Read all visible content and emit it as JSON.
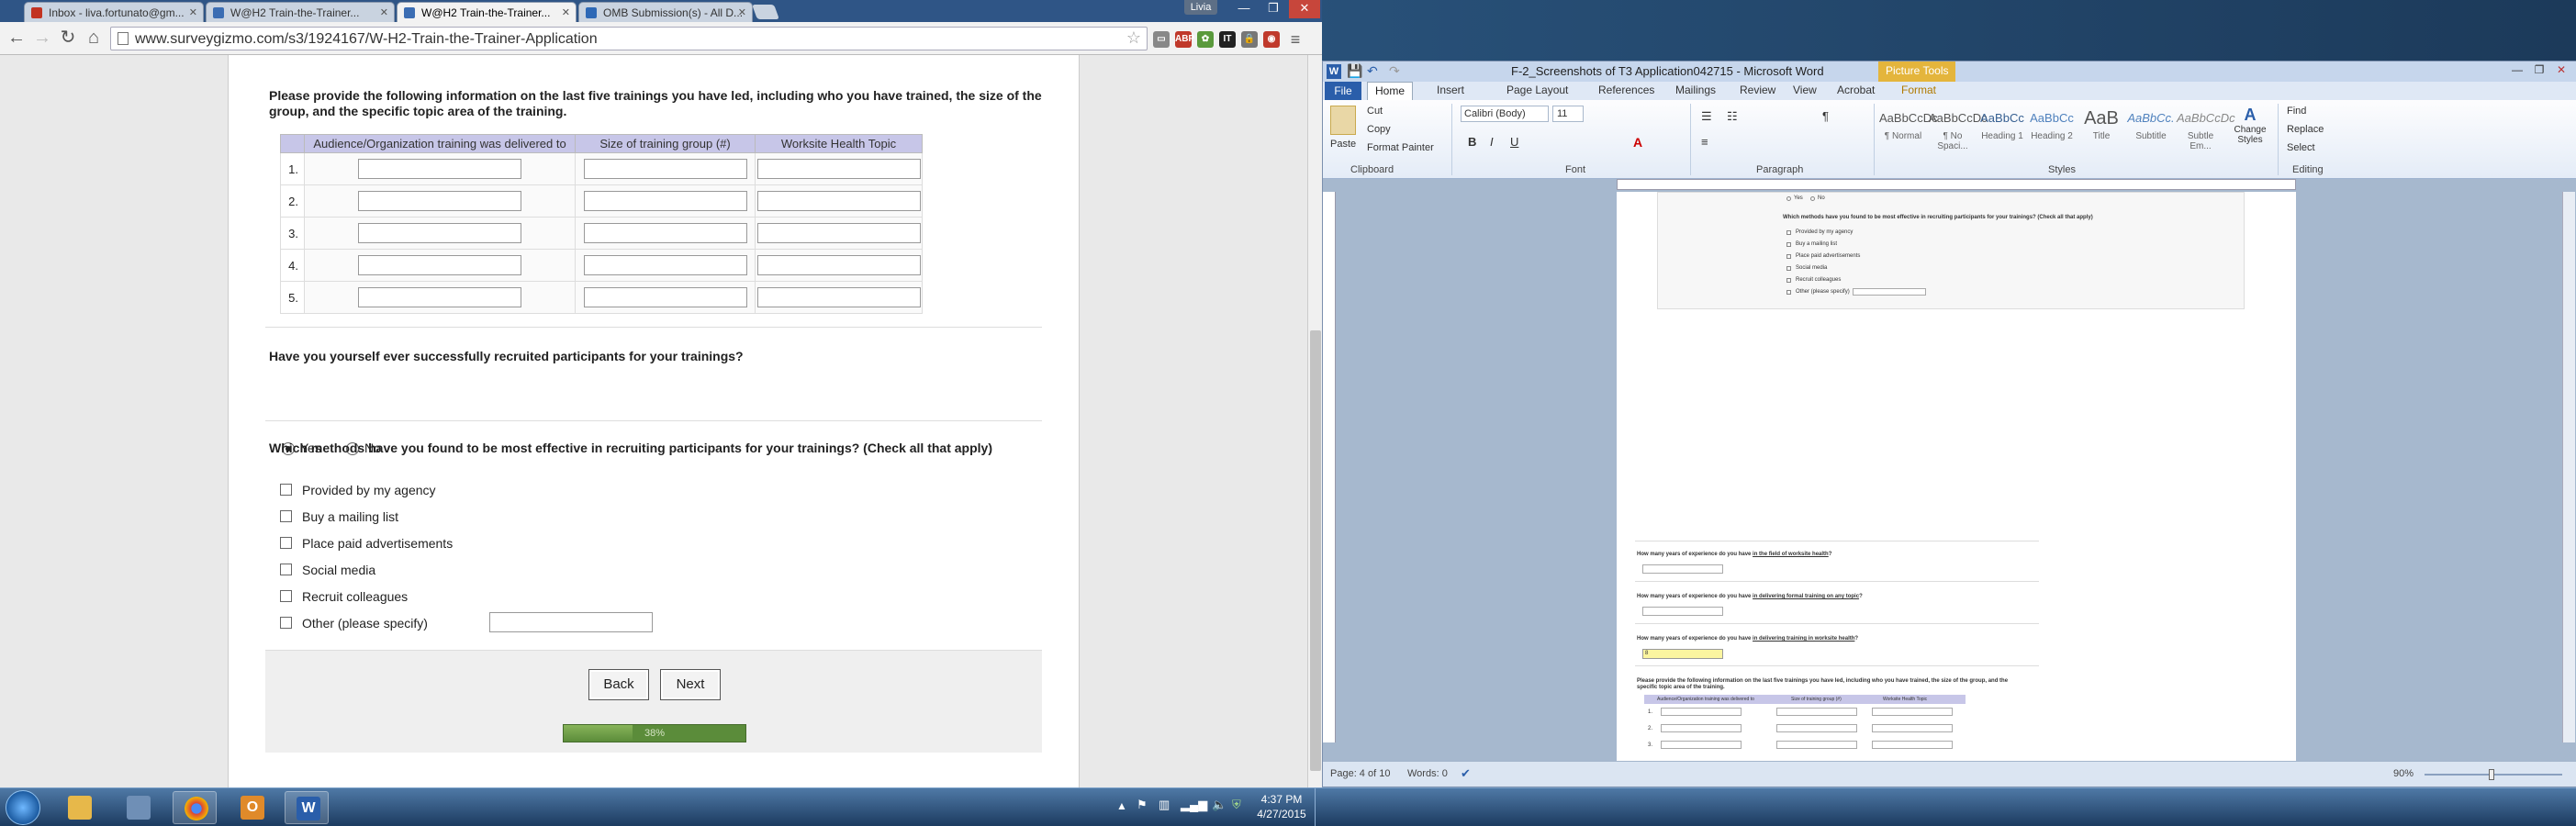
{
  "browser": {
    "tabs": [
      {
        "label": "Inbox - liva.fortunato@gm...",
        "favicon_color": "#c23321"
      },
      {
        "label": "W@H2 Train-the-Trainer...",
        "favicon_color": "#3b6db3"
      },
      {
        "label": "W@H2 Train-the-Trainer...",
        "favicon_color": "#3b6db3"
      },
      {
        "label": "OMB Submission(s) - All D...",
        "favicon_color": "#2d68b6"
      }
    ],
    "user": "Livia",
    "url": "www.surveygizmo.com/s3/1924167/W-H2-Train-the-Trainer-Application",
    "extensions": [
      "ABP",
      "evernote",
      "IT",
      "lock"
    ]
  },
  "survey": {
    "q_trainings": "Please provide the following information on the last five trainings you have led, including who you have trained, the size of the group, and the specific topic area of the training.",
    "table_headers": [
      "Audience/Organization training was delivered to",
      "Size of training group (#)",
      "Worksite Health Topic"
    ],
    "row_numbers": [
      "1.",
      "2.",
      "3.",
      "4.",
      "5."
    ],
    "q_recruited": "Have you yourself ever successfully recruited participants for your trainings?",
    "yes_label": "Yes",
    "no_label": "No",
    "recruited_selected": "Yes",
    "q_methods": "Which methods have you found to be most effective in recruiting participants for your trainings? (Check all that apply)",
    "methods": [
      "Provided by my agency",
      "Buy a mailing list",
      "Place paid advertisements",
      "Social media",
      "Recruit colleagues",
      "Other (please specify)"
    ],
    "back_label": "Back",
    "next_label": "Next",
    "progress_percent": 38,
    "progress_label": "38%"
  },
  "word": {
    "title": "F-2_Screenshots of T3 Application042715  -  Microsoft Word",
    "context_tab": "Picture Tools",
    "tabs": [
      "File",
      "Home",
      "Insert",
      "Page Layout",
      "References",
      "Mailings",
      "Review",
      "View",
      "Acrobat",
      "Format"
    ],
    "clipboard": {
      "paste": "Paste",
      "cut": "Cut",
      "copy": "Copy",
      "format_painter": "Format Painter",
      "label": "Clipboard"
    },
    "font": {
      "name": "Calibri (Body)",
      "size": "11",
      "label": "Font"
    },
    "paragraph_label": "Paragraph",
    "styles": [
      {
        "sample": "AaBbCcDc",
        "name": "¶ Normal"
      },
      {
        "sample": "AaBbCcDc",
        "name": "¶ No Spaci..."
      },
      {
        "sample": "AaBbCc",
        "name": "Heading 1"
      },
      {
        "sample": "AaBbCc",
        "name": "Heading 2"
      },
      {
        "sample": "AaB",
        "name": "Title"
      },
      {
        "sample": "AaBbCc.",
        "name": "Subtitle"
      },
      {
        "sample": "AaBbCcDc",
        "name": "Subtle Em..."
      }
    ],
    "styles_label": "Styles",
    "change_styles": "Change Styles",
    "editing": {
      "find": "Find",
      "replace": "Replace",
      "select": "Select",
      "label": "Editing"
    },
    "status": {
      "page": "Page: 4 of 10",
      "words": "Words: 0",
      "zoom": "90%"
    },
    "doc": {
      "embedded_yes": "Yes",
      "embedded_no": "No",
      "embedded_q": "Which methods have you found to be most effective in recruiting participants for your trainings? (Check all that apply)",
      "embedded_methods": [
        "Provided by my agency",
        "Buy a mailing list",
        "Place paid advertisements",
        "Social media",
        "Recruit colleagues",
        "Other (please specify)"
      ],
      "q_years_field_prefix": "How many years of experience do you have ",
      "q_years_field_link": "in the field of worksite health",
      "q_years_formal_link": "in delivering formal training on any topic",
      "q_years_wh_link": "in delivering training in worksite health",
      "answer_value": "8",
      "q_trainings": "Please provide the following information on the last five trainings you have led, including who you have trained, the size of the group, and the specific topic area of the training.",
      "table_headers": [
        "Audience/Organization training was delivered to",
        "Size of training group (#)",
        "Worksite Health Topic"
      ],
      "row_numbers": [
        "1.",
        "2.",
        "3."
      ]
    }
  },
  "taskbar": {
    "time": "4:37 PM",
    "date": "4/27/2015"
  }
}
